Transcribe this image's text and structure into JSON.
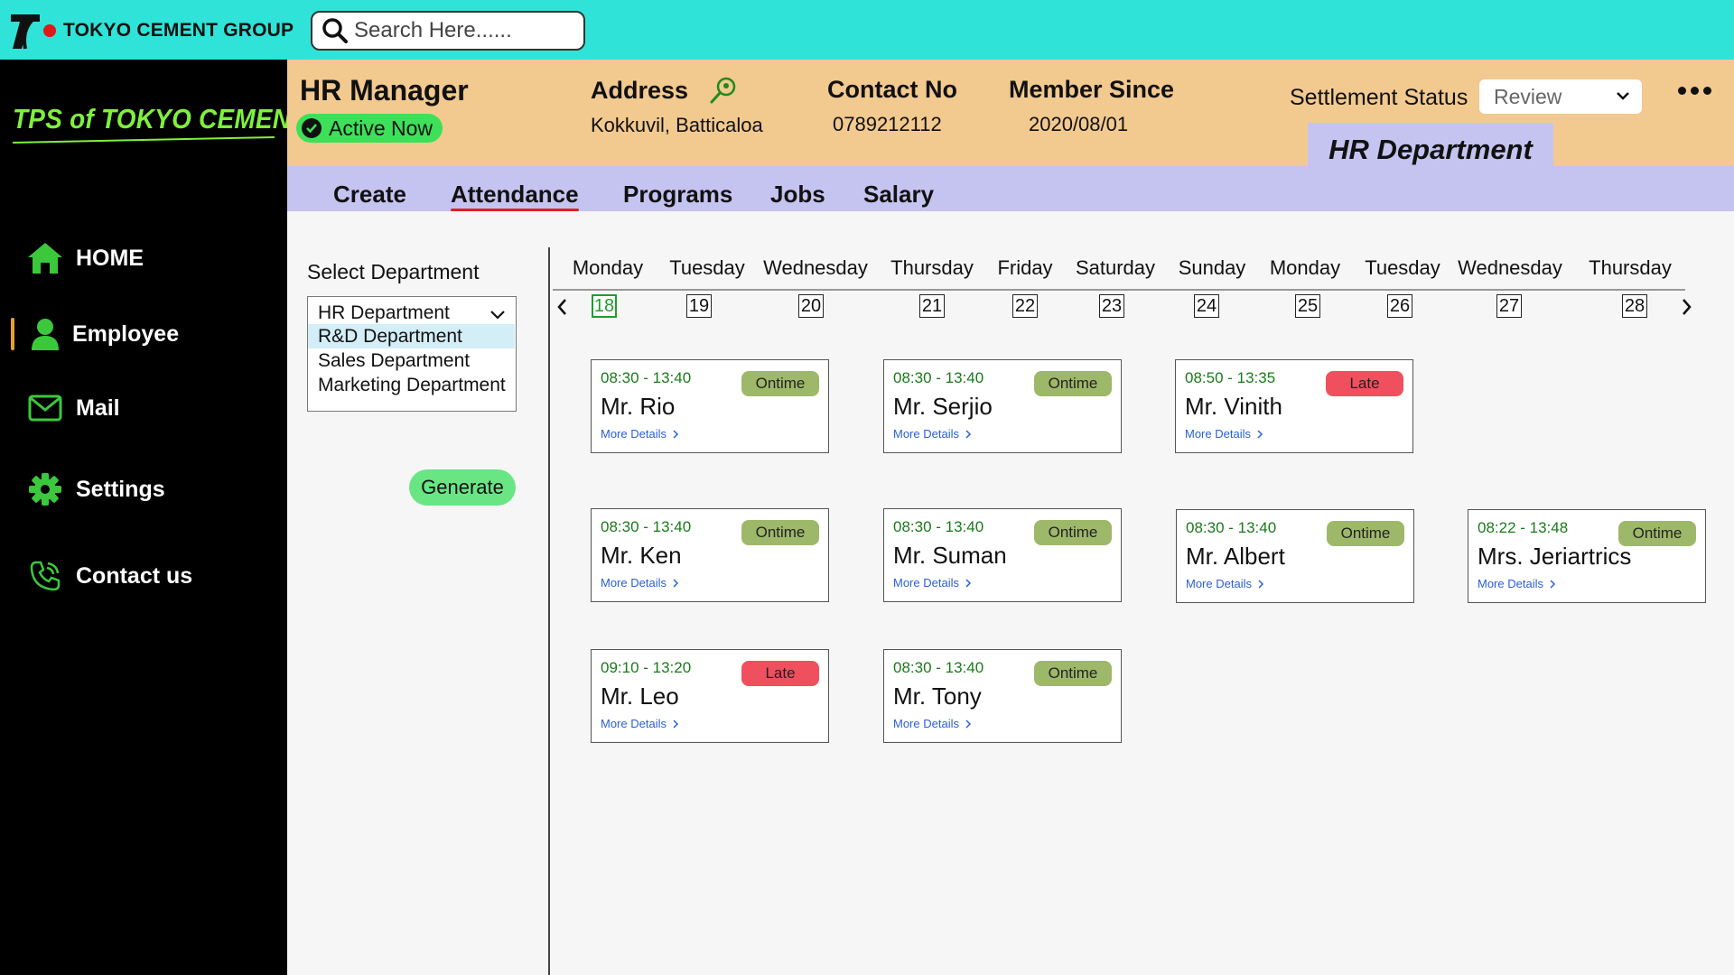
{
  "topbar": {
    "brand_name": "TOKYO CEMENT GROUP",
    "search_placeholder": "Search Here......",
    "colors": {
      "bar": "#2fe3d8",
      "brand_dot": "#e01818"
    }
  },
  "sidebar": {
    "title": "TPS of TOKYO CEMENT",
    "items": [
      {
        "label": "HOME",
        "icon": "home-icon"
      },
      {
        "label": "Employee",
        "icon": "user-icon",
        "active": true
      },
      {
        "label": "Mail",
        "icon": "mail-icon"
      },
      {
        "label": "Settings",
        "icon": "gear-icon"
      },
      {
        "label": "Contact us",
        "icon": "phone-icon"
      }
    ],
    "colors": {
      "accent": "#7ff03c",
      "icon": "#3cc83c"
    }
  },
  "profile": {
    "role": "HR Manager",
    "status": "Active Now",
    "address_label": "Address",
    "address_value": "Kokkuvil, Batticaloa",
    "contact_label": "Contact No",
    "contact_value": "0789212112",
    "member_label": "Member Since",
    "member_value": "2020/08/01",
    "settlement_label": "Settlement Status",
    "settlement_value": "Review",
    "department": "HR Department"
  },
  "tabs": [
    {
      "label": "Create"
    },
    {
      "label": "Attendance",
      "active": true
    },
    {
      "label": "Programs"
    },
    {
      "label": "Jobs"
    },
    {
      "label": "Salary"
    }
  ],
  "left_panel": {
    "select_label": "Select Department",
    "departments": [
      "HR Department",
      "R&D Department",
      "Sales Department",
      "Marketing Department"
    ],
    "selected_department": "R&D Department",
    "generate_label": "Generate"
  },
  "calendar": {
    "days": [
      "Monday",
      "Tuesday",
      "Wednesday",
      "Thursday",
      "Friday",
      "Saturday",
      "Sunday",
      "Monday",
      "Tuesday",
      "Wednesday",
      "Thursday"
    ],
    "dates": [
      "18",
      "19",
      "20",
      "21",
      "22",
      "23",
      "24",
      "25",
      "26",
      "27",
      "28"
    ],
    "today": "18"
  },
  "attendance": {
    "more_label": "More Details",
    "records": [
      {
        "time": "08:30 - 13:40",
        "name": "Mr. Rio",
        "status": "Ontime"
      },
      {
        "time": "08:30 - 13:40",
        "name": "Mr. Serjio",
        "status": "Ontime"
      },
      {
        "time": "08:50 - 13:35",
        "name": "Mr. Vinith",
        "status": "Late"
      },
      {
        "time": "08:30 - 13:40",
        "name": "Mr. Ken",
        "status": "Ontime"
      },
      {
        "time": "08:30 - 13:40",
        "name": "Mr. Suman",
        "status": "Ontime"
      },
      {
        "time": "08:30 - 13:40",
        "name": "Mr. Albert",
        "status": "Ontime"
      },
      {
        "time": "08:22 - 13:48",
        "name": "Mrs. Jeriartrics",
        "status": "Ontime"
      },
      {
        "time": "09:10 - 13:20",
        "name": "Mr. Leo",
        "status": "Late"
      },
      {
        "time": "08:30 - 13:40",
        "name": "Mr. Tony",
        "status": "Ontime"
      }
    ],
    "colors": {
      "ontime": "#9eb86a",
      "late": "#f0505e"
    }
  }
}
